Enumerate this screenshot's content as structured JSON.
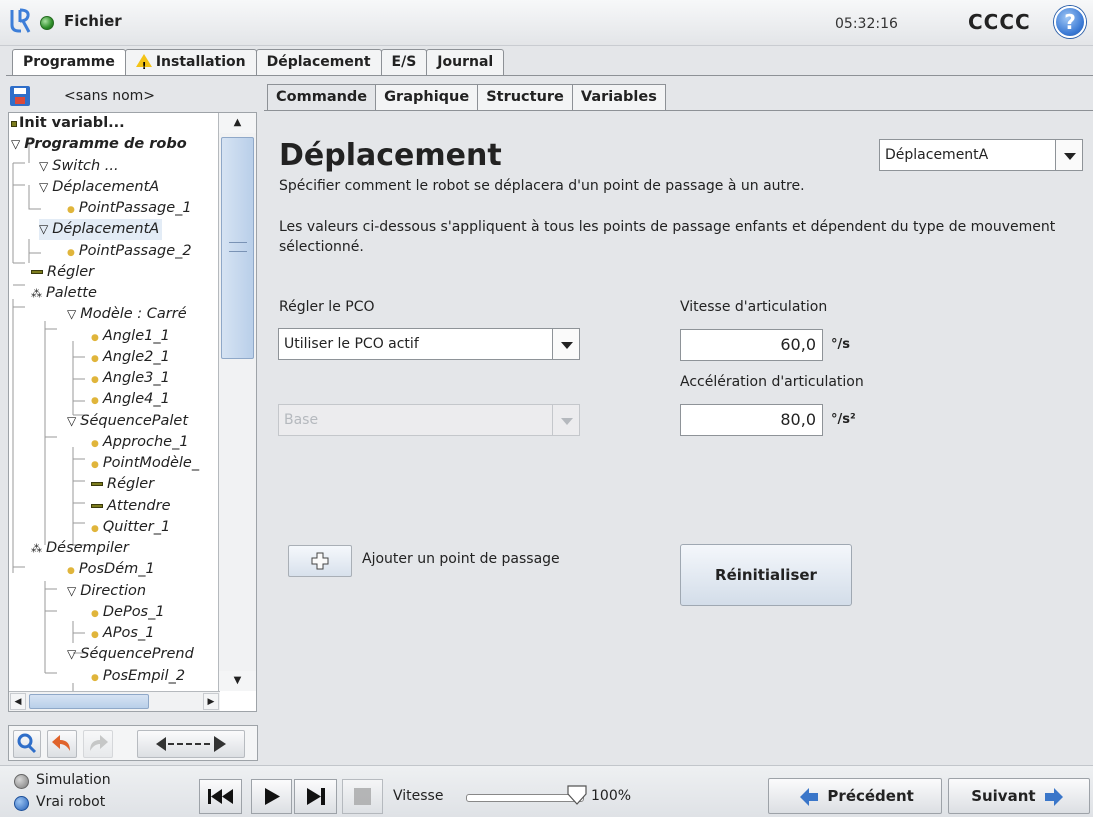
{
  "header": {
    "menu_label": "Fichier",
    "time": "05:32:16",
    "robot_name": "CCCC",
    "help_symbol": "?",
    "status_color": "#2f8f2a"
  },
  "main_tabs": [
    {
      "label": "Programme",
      "active": true
    },
    {
      "label": "Installation",
      "warning_icon": "warning-triangle-icon"
    },
    {
      "label": "Déplacement"
    },
    {
      "label": "E/S"
    },
    {
      "label": "Journal"
    }
  ],
  "program": {
    "name": "<sans nom>",
    "tree": [
      {
        "label": "Init variabl...",
        "icon": "bar",
        "bold": true,
        "italic": false
      },
      {
        "label": "Programme de robo",
        "icon": "triangle",
        "bold": true
      },
      {
        "label": "Switch ...",
        "icon": "triangle"
      },
      {
        "label": "DéplacementA",
        "icon": "triangle"
      },
      {
        "label": "PointPassage_1",
        "icon": "dot"
      },
      {
        "label": "DéplacementA",
        "icon": "triangle",
        "selected": true
      },
      {
        "label": "PointPassage_2",
        "icon": "dot"
      },
      {
        "label": "Régler",
        "icon": "bar"
      },
      {
        "label": "Palette",
        "icon": "palette"
      },
      {
        "label": "Modèle : Carré",
        "icon": "triangle"
      },
      {
        "label": "Angle1_1",
        "icon": "dot"
      },
      {
        "label": "Angle2_1",
        "icon": "dot"
      },
      {
        "label": "Angle3_1",
        "icon": "dot"
      },
      {
        "label": "Angle4_1",
        "icon": "dot"
      },
      {
        "label": "SéquencePalet",
        "icon": "triangle"
      },
      {
        "label": "Approche_1",
        "icon": "dot"
      },
      {
        "label": "PointModèle_",
        "icon": "dot"
      },
      {
        "label": "Régler",
        "icon": "bar"
      },
      {
        "label": "Attendre",
        "icon": "bar"
      },
      {
        "label": "Quitter_1",
        "icon": "dot"
      },
      {
        "label": "Désempiler",
        "icon": "palette"
      },
      {
        "label": "PosDém_1",
        "icon": "dot"
      },
      {
        "label": "Direction",
        "icon": "triangle"
      },
      {
        "label": "DePos_1",
        "icon": "dot"
      },
      {
        "label": "APos_1",
        "icon": "dot"
      },
      {
        "label": "SéquencePrend",
        "icon": "triangle"
      },
      {
        "label": "PosEmpil_2",
        "icon": "dot"
      }
    ]
  },
  "sub_tabs": [
    {
      "label": "Commande",
      "active": true
    },
    {
      "label": "Graphique"
    },
    {
      "label": "Structure"
    },
    {
      "label": "Variables"
    }
  ],
  "command": {
    "title": "Déplacement",
    "move_select": "DéplacementA",
    "description": "Spécifier comment le robot se déplacera d'un point de passage à un autre.",
    "note": "Les valeurs ci-dessous s'appliquent à tous les points de passage enfants et dépendent du type de mouvement sélectionné.",
    "tcp_label": "Régler le PCO",
    "tcp_value": "Utiliser le PCO actif",
    "feature_value": "Base",
    "joint_speed_label": "Vitesse d'articulation",
    "joint_speed_value": "60,0",
    "joint_speed_unit": "°/s",
    "joint_accel_label": "Accélération d'articulation",
    "joint_accel_value": "80,0",
    "joint_accel_unit": "°/s²",
    "add_waypoint_label": "Ajouter un point de passage",
    "reset_label": "Réinitialiser"
  },
  "footer": {
    "simulation_label": "Simulation",
    "real_robot_label": "Vrai robot",
    "speed_label": "Vitesse",
    "speed_value": "100%",
    "speed_fraction": 1.0,
    "prev_label": "Précédent",
    "next_label": "Suivant"
  }
}
